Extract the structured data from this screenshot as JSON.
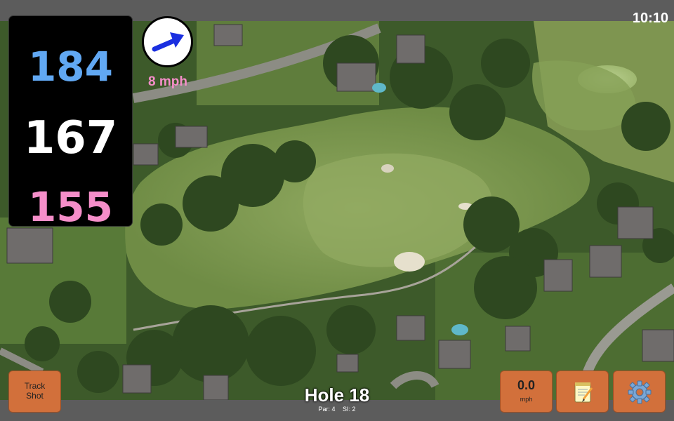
{
  "status_bar": {
    "time": "10:10"
  },
  "distances": {
    "back": "184",
    "middle": "167",
    "front": "155"
  },
  "wind": {
    "speed_label": "8 mph",
    "arrow_icon": "wind-direction-arrow-icon"
  },
  "hole": {
    "title": "Hole 18",
    "par": "Par: 4",
    "si": "SI: 2"
  },
  "buttons": {
    "track_shot_line1": "Track",
    "track_shot_line2": "Shot",
    "wind_value": "0.0",
    "wind_unit": "mph",
    "notes_icon": "notepad-icon",
    "settings_icon": "gear-icon"
  },
  "colors": {
    "back_distance": "#61a8f3",
    "middle_distance": "#ffffff",
    "front_distance": "#f58ec9",
    "button_bg": "#d2703b",
    "bar_bg": "#5c5c5c"
  }
}
